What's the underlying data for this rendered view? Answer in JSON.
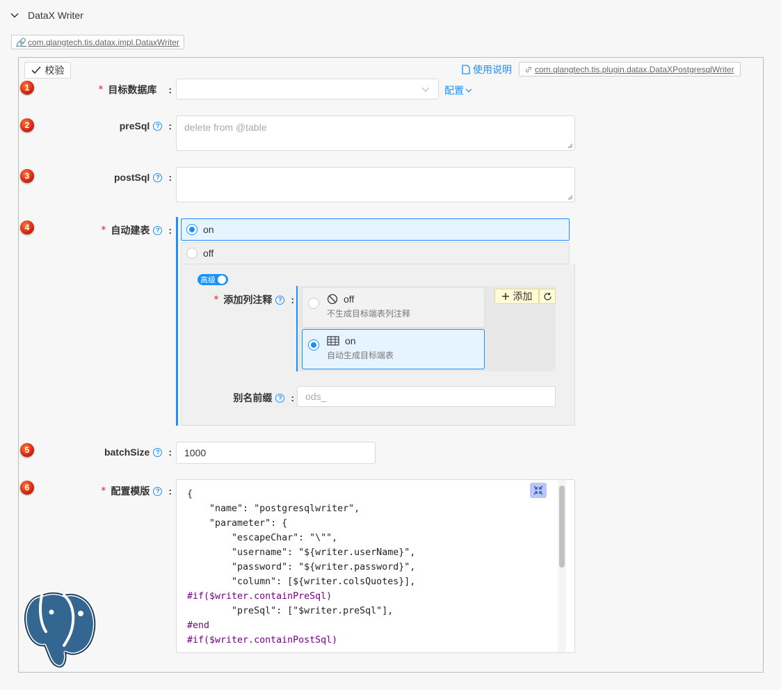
{
  "header": {
    "title": "DataX Writer",
    "class_name": "com.qlangtech.tis.datax.impl.DataxWriter"
  },
  "toolbar": {
    "verify_label": "校验",
    "doc_label": "使用说明",
    "plugin_class": "com.qlangtech.tis.plugin.datax.DataXPostgresqlWriter"
  },
  "badges": [
    "1",
    "2",
    "3",
    "4",
    "5",
    "6"
  ],
  "fields": {
    "target_db": {
      "label": "目标数据库",
      "required": "*",
      "value": "",
      "config_label": "配置"
    },
    "pre_sql": {
      "label": "preSql",
      "placeholder": "delete from @table",
      "value": ""
    },
    "post_sql": {
      "label": "postSql",
      "placeholder": "",
      "value": ""
    },
    "auto_create": {
      "label": "自动建表",
      "required": "*",
      "options": [
        {
          "label": "on",
          "selected": true
        },
        {
          "label": "off",
          "selected": false
        }
      ],
      "advanced_label": "高级",
      "add_comment": {
        "label": "添加列注释",
        "required": "*",
        "options": [
          {
            "label": "off",
            "desc": "不生成目标端表列注释",
            "icon": "ban-icon",
            "selected": false
          },
          {
            "label": "on",
            "desc": "自动生成目标端表",
            "icon": "table-icon",
            "selected": true
          }
        ],
        "add_label": "添加"
      },
      "alias_prefix": {
        "label": "别名前缀",
        "placeholder": "ods_",
        "value": ""
      }
    },
    "batch_size": {
      "label": "batchSize",
      "value": "1000"
    },
    "template": {
      "label": "配置模版",
      "required": "*"
    }
  },
  "code_lines": [
    "{",
    "    \"name\": \"postgresqlwriter\",",
    "    \"parameter\": {",
    "        \"escapeChar\": \"\\\"\",",
    "        \"username\": \"${writer.userName}\",",
    "        \"password\": \"${writer.password}\",",
    "        \"column\": [${writer.colsQuotes}],",
    "#if($writer.containPreSql)",
    "        \"preSql\": [\"$writer.preSql\"],",
    "#end",
    "#if($writer.containPostSql)"
  ],
  "colors": {
    "accent": "#1890ff",
    "required": "#e02020",
    "badge": "#d3240f"
  }
}
